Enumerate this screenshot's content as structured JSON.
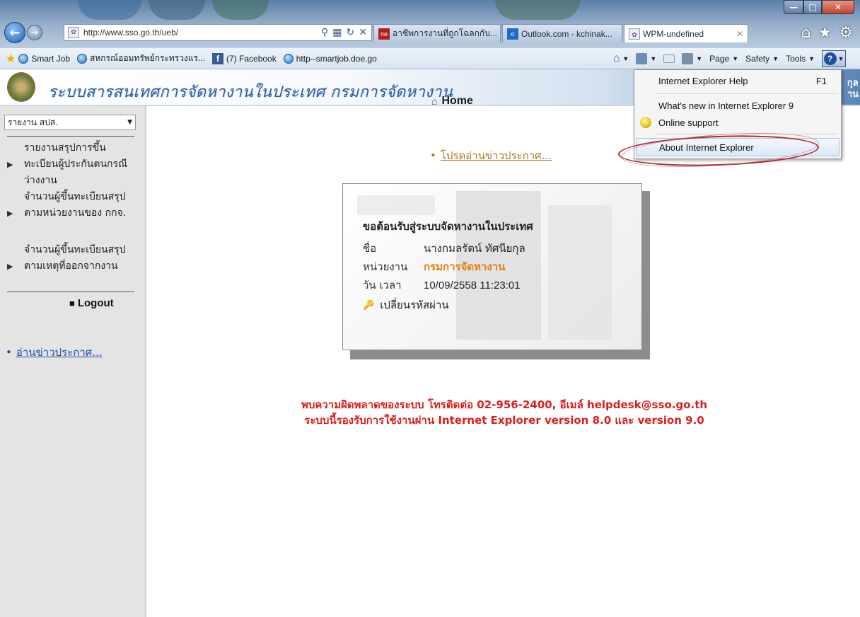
{
  "browser": {
    "address": "http://www.sso.go.th/ueb/",
    "tabs": [
      {
        "label": "อาชีพการงานที่ถูกโฉลกกับ...",
        "icon": "news-icon"
      },
      {
        "label": "Outlook.com - kchinak...",
        "icon": "outlook-icon"
      },
      {
        "label": "WPM-undefined",
        "icon": "sso-icon"
      }
    ],
    "favorites": [
      {
        "label": "Smart Job",
        "icon": "ie-icon"
      },
      {
        "label": "สหกรณ์ออมทรัพย์กระทรวงแร...",
        "icon": "ie-icon"
      },
      {
        "label": "(7) Facebook",
        "icon": "facebook-icon"
      },
      {
        "label": "http--smartjob.doe.go",
        "icon": "ie-icon"
      }
    ],
    "command_bar": {
      "page": "Page",
      "safety": "Safety",
      "tools": "Tools"
    }
  },
  "help_menu": {
    "items": [
      {
        "label": "Internet Explorer Help",
        "shortcut": "F1"
      },
      {
        "label": "What's new in Internet Explorer 9",
        "shortcut": ""
      },
      {
        "label": "Online support",
        "shortcut": ""
      },
      {
        "label": "About Internet Explorer",
        "shortcut": ""
      }
    ]
  },
  "banner": {
    "title": "ระบบสารสนเทศการจัดหางานในประเทศ กรมการจัดหางาน",
    "home_label": "Home",
    "right_text_1": "กุล",
    "right_text_2": "าน"
  },
  "sidebar": {
    "select_value": "รายงาน สปส.",
    "items": [
      "รายงานสรุปการขึ้นทะเบียนผู้ประกันตนกรณีว่างงาน",
      "จำนวนผู้ขึ้นทะเบียนสรุปตามหน่วยงานของ กกจ.",
      "จำนวนผู้ขึ้นทะเบียนสรุปตามเหตุที่ออกจากงาน"
    ],
    "logout_label": "Logout",
    "news_link": "อ่านข่าวประกาศ..."
  },
  "main": {
    "news_link": "โปรดอ่านข่าวประกาศ...",
    "welcome": {
      "title": "ขอต้อนรับสู่ระบบจัดหางานในประเทศ",
      "name_label": "ชื่อ",
      "name_value": "นางกมลรัตน์ ทัศนียกุล",
      "org_label": "หน่วยงาน",
      "org_value": "กรมการจัดหางาน",
      "datetime_label": "วัน เวลา",
      "datetime_value": "10/09/2558 11:23:01",
      "change_password": "เปลี่ยนรหัสผ่าน"
    },
    "error_line_1": "พบความผิดพลาดของระบบ โทรติดต่อ 02-956-2400, อีเมล์ helpdesk@sso.go.th",
    "error_line_2": "ระบบนี้รองรับการใช้งานผ่าน Internet Explorer version 8.0 และ version 9.0"
  },
  "colors": {
    "error_text": "#dd1d1d",
    "link_blue": "#1a4db0",
    "news_orange": "#b07a1f",
    "org_orange": "#e0800e",
    "annotation_red": "#b0232a"
  }
}
